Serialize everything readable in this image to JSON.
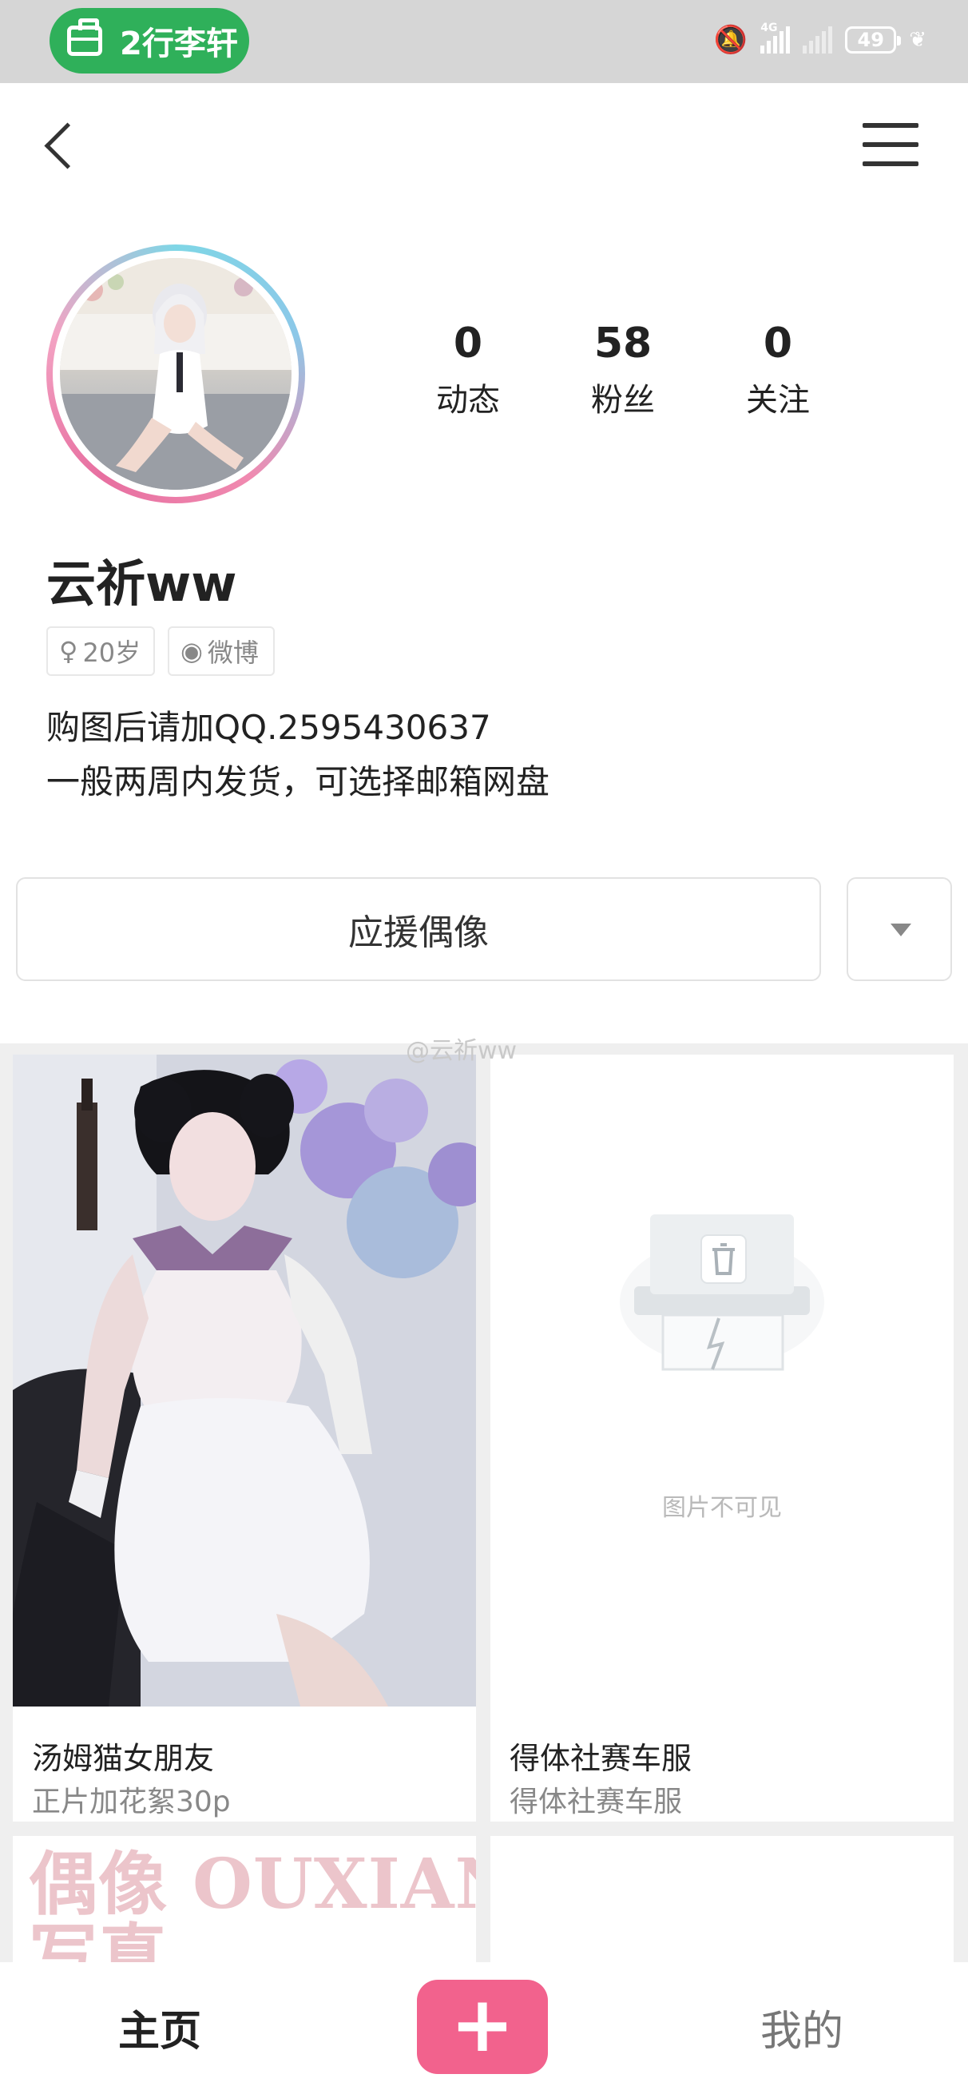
{
  "status_bar": {
    "trip_label": "2行李轩",
    "network_label": "4G",
    "battery": "49",
    "colors": {
      "trip_pill": "#2fb05a",
      "bar_bg": "#d6d6d6"
    }
  },
  "header": {
    "back_icon": "chevron-left-icon",
    "menu_icon": "hamburger-menu-icon"
  },
  "profile": {
    "username": "云祈ww",
    "stats": [
      {
        "value": "0",
        "label": "动态"
      },
      {
        "value": "58",
        "label": "粉丝"
      },
      {
        "value": "0",
        "label": "关注"
      }
    ],
    "tags": [
      {
        "icon": "female-icon",
        "text": "20岁"
      },
      {
        "icon": "weibo-icon",
        "text": "微博"
      }
    ],
    "bio": [
      "购图后请加QQ.2595430637",
      "一般两周内发货，可选择邮箱网盘"
    ]
  },
  "actions": {
    "support_label": "应援偶像",
    "dropdown_icon": "triangle-down-icon"
  },
  "feed": {
    "watermark": "@云祈ww",
    "cards": [
      {
        "title": "汤姆猫女朋友",
        "subtitle": "正片加花絮30p"
      },
      {
        "title": "得体社赛车服",
        "subtitle": "得体社赛车服",
        "placeholder_text": "图片不可见"
      }
    ],
    "teaser": {
      "lines": [
        "偶像 OUXIANG",
        "写真"
      ]
    }
  },
  "bottom_nav": {
    "home": "主页",
    "add": "+",
    "mine": "我的",
    "colors": {
      "add_button": "#f2628d"
    }
  }
}
